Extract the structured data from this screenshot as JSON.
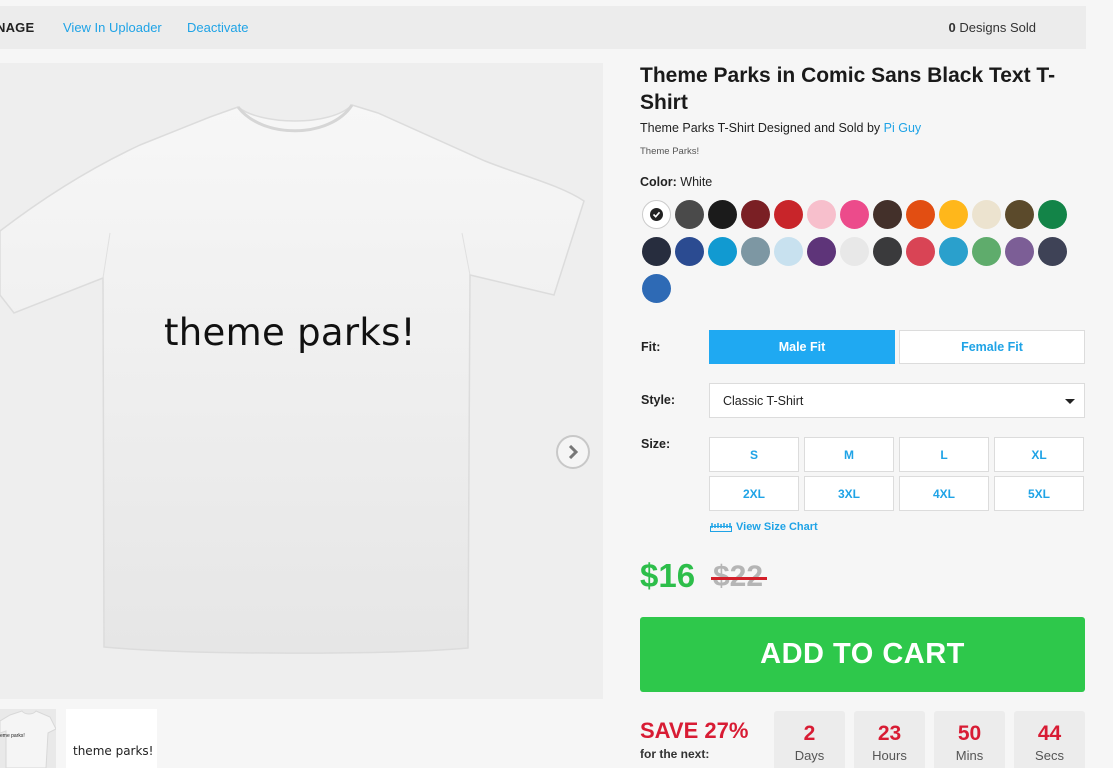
{
  "topbar": {
    "manage_label": "NAGE",
    "view_uploader": "View In Uploader",
    "deactivate": "Deactivate",
    "sold_count": "0",
    "sold_label": " Designs Sold"
  },
  "product": {
    "title": "Theme Parks in Comic Sans Black Text T-Shirt",
    "byline_prefix": "Theme Parks T-Shirt Designed and Sold by ",
    "artist": "Pi Guy",
    "tagline": "Theme Parks!",
    "shirt_print": "theme parks!",
    "thumb_print": "theme parks!",
    "thumb_small_print": "eme parks!"
  },
  "color": {
    "label": "Color:",
    "selected": " White",
    "swatches": [
      "#ffffff",
      "#4a4a4a",
      "#1b1b1b",
      "#7a1f24",
      "#c8252a",
      "#f7bfcc",
      "#ec4b8b",
      "#43302a",
      "#e24e12",
      "#ffb71b",
      "#ece3cf",
      "#5b4a2b",
      "#138448",
      "#272d3e",
      "#2b4b91",
      "#119ad1",
      "#7d97a3",
      "#c8e1ef",
      "#5e3479",
      "#e8e8e8",
      "#3a3a3c",
      "#d94455",
      "#2aa0cc",
      "#5fac6c",
      "#7c5e96",
      "#3e4256",
      "#2e6ab5"
    ]
  },
  "fit": {
    "label": "Fit:",
    "male": "Male Fit",
    "female": "Female Fit"
  },
  "style": {
    "label": "Style:",
    "value": "Classic T-Shirt"
  },
  "size": {
    "label": "Size:",
    "options": [
      "S",
      "M",
      "L",
      "XL",
      "2XL",
      "3XL",
      "4XL",
      "5XL"
    ],
    "chart_link": "View Size Chart"
  },
  "pricing": {
    "price": "$16",
    "old_price": "$22",
    "cart": "ADD TO CART",
    "save": "SAVE 27%",
    "for_next": "for the next:",
    "countdown": [
      {
        "num": "2",
        "unit": "Days"
      },
      {
        "num": "23",
        "unit": "Hours"
      },
      {
        "num": "50",
        "unit": "Mins"
      },
      {
        "num": "44",
        "unit": "Secs"
      }
    ]
  },
  "colors": {
    "accent_blue": "#1fa9f2",
    "cart_green": "#2ec84b",
    "sale_red": "#d81c34"
  }
}
